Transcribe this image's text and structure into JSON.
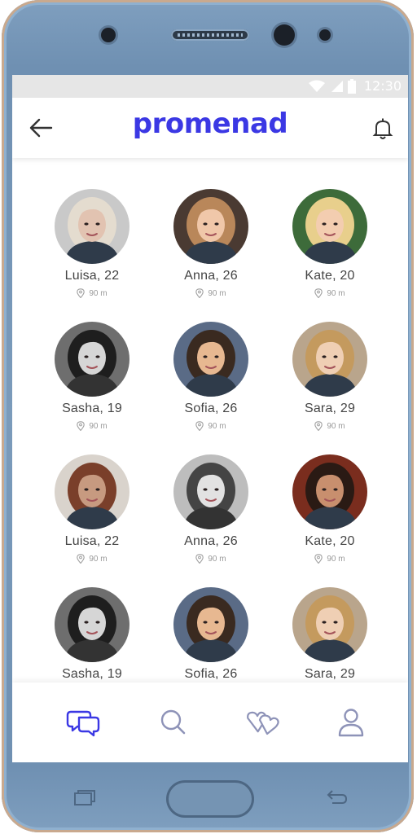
{
  "status_bar": {
    "time": "12:30"
  },
  "header": {
    "title": "promenad",
    "back_icon": "arrow-left-icon",
    "bell_icon": "bell-icon"
  },
  "profiles": [
    {
      "name": "Luisa, 22",
      "distance": "90 m",
      "tone": "#c9c9c9",
      "hair": "#e4dccf",
      "skin": "#e2c3b1",
      "bw": false
    },
    {
      "name": "Anna, 26",
      "distance": "90 m",
      "tone": "#4a3a32",
      "hair": "#b9875a",
      "skin": "#f0c7a9",
      "bw": false
    },
    {
      "name": "Kate, 20",
      "distance": "90 m",
      "tone": "#3d6b3a",
      "hair": "#e8cf8c",
      "skin": "#f3cdb0",
      "bw": false
    },
    {
      "name": "Sasha, 19",
      "distance": "90 m",
      "tone": "#6e6e6e",
      "hair": "#1e1e1e",
      "skin": "#d6d6d6",
      "bw": true
    },
    {
      "name": "Sofia, 26",
      "distance": "90 m",
      "tone": "#5a6b86",
      "hair": "#3a2a20",
      "skin": "#e7b891",
      "bw": false
    },
    {
      "name": "Sara, 29",
      "distance": "90 m",
      "tone": "#b9a58c",
      "hair": "#c49a5e",
      "skin": "#efcfb4",
      "bw": false
    },
    {
      "name": "Luisa, 22",
      "distance": "90 m",
      "tone": "#d9d3cc",
      "hair": "#7a3f2a",
      "skin": "#c79a80",
      "bw": false
    },
    {
      "name": "Anna, 26",
      "distance": "90 m",
      "tone": "#bdbdbd",
      "hair": "#444444",
      "skin": "#e2e2e2",
      "bw": true
    },
    {
      "name": "Kate, 20",
      "distance": "90 m",
      "tone": "#7a2d1e",
      "hair": "#2a1a14",
      "skin": "#c88f6e",
      "bw": false
    },
    {
      "name": "Sasha, 19",
      "distance": "90 m",
      "tone": "#6e6e6e",
      "hair": "#1e1e1e",
      "skin": "#d6d6d6",
      "bw": true
    },
    {
      "name": "Sofia, 26",
      "distance": "90 m",
      "tone": "#5a6b86",
      "hair": "#3a2a20",
      "skin": "#e7b891",
      "bw": false
    },
    {
      "name": "Sara, 29",
      "distance": "90 m",
      "tone": "#b9a58c",
      "hair": "#c49a5e",
      "skin": "#efcfb4",
      "bw": false
    }
  ],
  "bottom_nav": [
    {
      "icon": "chat-bubbles-icon",
      "active": true
    },
    {
      "icon": "search-icon",
      "active": false
    },
    {
      "icon": "hearts-icon",
      "active": false
    },
    {
      "icon": "profile-icon",
      "active": false
    }
  ],
  "colors": {
    "accent": "#3b38e4",
    "inactive": "#8e93b8",
    "text": "#444444",
    "muted": "#9a9a9a"
  }
}
